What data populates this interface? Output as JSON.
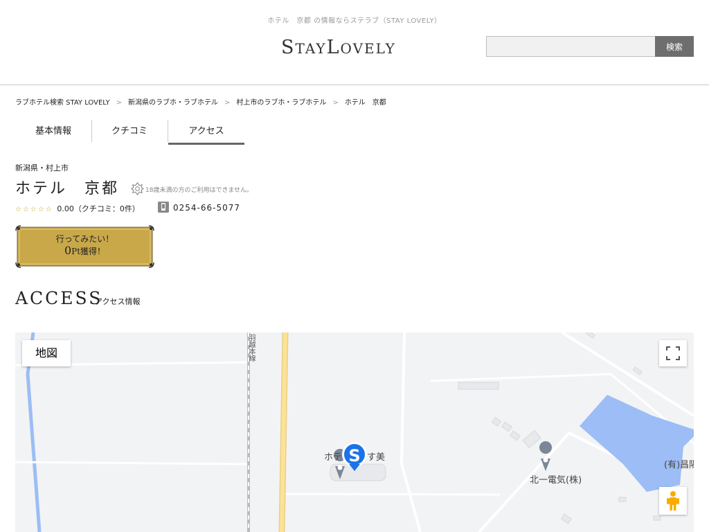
{
  "header": {
    "tagline": "ホテル　京都 の情報ならステラブ（STAY LOVELY）",
    "logo": {
      "s": "S",
      "tay": "TAY",
      "l": "L",
      "ovely": "OVELY"
    },
    "search_placeholder": "",
    "search_button": "検索"
  },
  "breadcrumb": [
    "ラブホテル検索 STAY LOVELY",
    "新潟県のラブホ・ラブホテル",
    "村上市のラブホ・ラブホテル",
    "ホテル　京都"
  ],
  "breadcrumb_separator": ">",
  "tabs": [
    {
      "label": "基本情報",
      "active": false
    },
    {
      "label": "クチコミ",
      "active": false
    },
    {
      "label": "アクセス",
      "active": true
    }
  ],
  "hotel": {
    "prefecture": "新潟県・村上市",
    "name": "ホテル　京都",
    "age_note": "18歳未満の方のご利用はできません。",
    "stars": "☆☆☆☆☆",
    "rating_text": "0.00（クチコミ：0件）",
    "rating": 0,
    "review_count": 0,
    "phone": "0254-66-5077"
  },
  "want_button": {
    "line1": "行ってみたい！",
    "points": "0",
    "pt_unit": "Pt",
    "suffix": "獲得！"
  },
  "access": {
    "title": "ACCESS",
    "subtitle": "アクセス情報"
  },
  "map": {
    "type_button": "地図",
    "labels": {
      "hotel_left": "ホテ",
      "hotel_right": "す美",
      "business": "北一電気(株)",
      "business_right": "(有)昌陽",
      "railway": "羽越本線"
    }
  },
  "colors": {
    "gold": "#c9a84a",
    "water": "#9cbdf5",
    "road_yellow": "#fde293",
    "marker_blue": "#1a73e8"
  }
}
